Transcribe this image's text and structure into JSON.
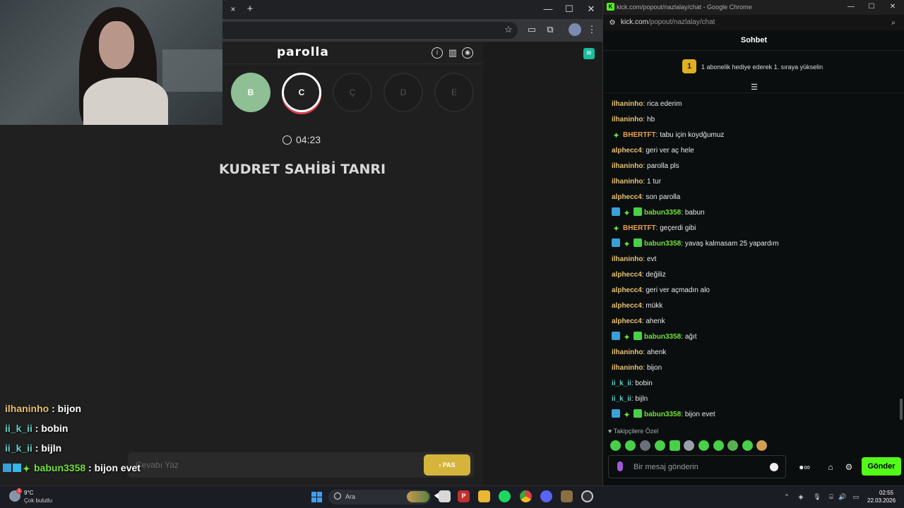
{
  "left_browser": {
    "tab_close": "×",
    "new_tab": "+",
    "controls": {
      "minimize": "—",
      "maximize": "☐",
      "close": "✕"
    }
  },
  "game": {
    "title": "parolla",
    "letters": [
      {
        "char": "B",
        "state": "done"
      },
      {
        "char": "C",
        "state": "active"
      },
      {
        "char": "Ç",
        "state": "todo"
      },
      {
        "char": "D",
        "state": "todo"
      },
      {
        "char": "E",
        "state": "todo"
      }
    ],
    "timer": "04:23",
    "question": "KUDRET SAHİBİ TANRI",
    "answer_placeholder": "Cevabı Yaz",
    "pass_label": "PAS",
    "pass_chevron": "›"
  },
  "overlay_chat": [
    {
      "user": "ilhaninho",
      "sep": " : ",
      "text": "bijon",
      "color": "#e8c070"
    },
    {
      "user": "ii_k_ii",
      "sep": " : ",
      "text": "bobin",
      "color": "#5fd0c8"
    },
    {
      "user": "ii_k_ii",
      "sep": " : ",
      "text": "bijln",
      "color": "#5fd0c8"
    },
    {
      "user": "babun3358",
      "sep": " : ",
      "text": "bijon evet",
      "color": "#72e03a"
    }
  ],
  "chat_window": {
    "favicon": "K",
    "window_title": "kick.com/popout/nazlalay/chat - Google Chrome",
    "url_host": "kick.com",
    "url_path": "/popout/nazlalay/chat",
    "header": "Sohbet",
    "pinned": {
      "rank": "1",
      "text": "1 abonelik hediye ederek 1. sıraya yükselin"
    },
    "messages": [
      {
        "user": "ilhaninho",
        "text": "rica ederim",
        "color": "#e8c070",
        "badges": []
      },
      {
        "user": "ilhaninho",
        "text": "hb",
        "color": "#e8c070",
        "badges": []
      },
      {
        "user": "BHERTFT",
        "text": "tabu için koydğumuz",
        "color": "#e8a050",
        "badges": [
          "star"
        ]
      },
      {
        "user": "alphecc4",
        "text": "geri ver aç hele",
        "color": "#e8c070",
        "badges": []
      },
      {
        "user": "ilhaninho",
        "text": "parolla pls",
        "color": "#e8c070",
        "badges": []
      },
      {
        "user": "ilhaninho",
        "text": "1 tur",
        "color": "#e8c070",
        "badges": []
      },
      {
        "user": "alphecc4",
        "text": "son parolla",
        "color": "#e8c070",
        "badges": []
      },
      {
        "user": "babun3358",
        "text": "babun",
        "color": "#72e03a",
        "badges": [
          "vip",
          "star",
          "gift"
        ]
      },
      {
        "user": "BHERTFT",
        "text": "geçerdi gibi",
        "color": "#e8a050",
        "badges": [
          "star"
        ]
      },
      {
        "user": "babun3358",
        "text": "yavaş kalmasam 25 yapardım",
        "color": "#72e03a",
        "badges": [
          "vip",
          "star",
          "gift"
        ]
      },
      {
        "user": "ilhaninho",
        "text": "evt",
        "color": "#e8c070",
        "badges": []
      },
      {
        "user": "alphecc4",
        "text": "değiliz",
        "color": "#e8c070",
        "badges": []
      },
      {
        "user": "alphecc4",
        "text": "geri ver açmadın alo",
        "color": "#e8c070",
        "badges": []
      },
      {
        "user": "alphecc4",
        "text": "mükk",
        "color": "#e8c070",
        "badges": []
      },
      {
        "user": "alphecc4",
        "text": "ahenk",
        "color": "#e8c070",
        "badges": []
      },
      {
        "user": "babun3358",
        "text": "ağıt",
        "color": "#72e03a",
        "badges": [
          "vip",
          "star",
          "gift"
        ]
      },
      {
        "user": "ilhaninho",
        "text": "ahenk",
        "color": "#e8c070",
        "badges": []
      },
      {
        "user": "ilhaninho",
        "text": "bijon",
        "color": "#e8c070",
        "badges": []
      },
      {
        "user": "ii_k_ii",
        "text": "bobin",
        "color": "#5fd0c8",
        "badges": []
      },
      {
        "user": "ii_k_ii",
        "text": "bijln",
        "color": "#5fd0c8",
        "badges": []
      },
      {
        "user": "babun3358",
        "text": "bijon evet",
        "color": "#72e03a",
        "badges": [
          "vip",
          "star",
          "gift"
        ]
      }
    ],
    "followers_only": "Takipçilere Özel",
    "input_placeholder": "Bir mesaj gönderin",
    "send_label": "Gönder"
  },
  "taskbar": {
    "weather_temp": "9°C",
    "weather_desc": "Çok bulutlu",
    "search_text": "Ara",
    "time": "02:55",
    "date": "22.03.2026"
  },
  "colors": {
    "kick_green": "#53fc18",
    "pass_yellow": "#d4b43a",
    "letter_done": "#8fbf94",
    "active_ring": "#e04050"
  }
}
